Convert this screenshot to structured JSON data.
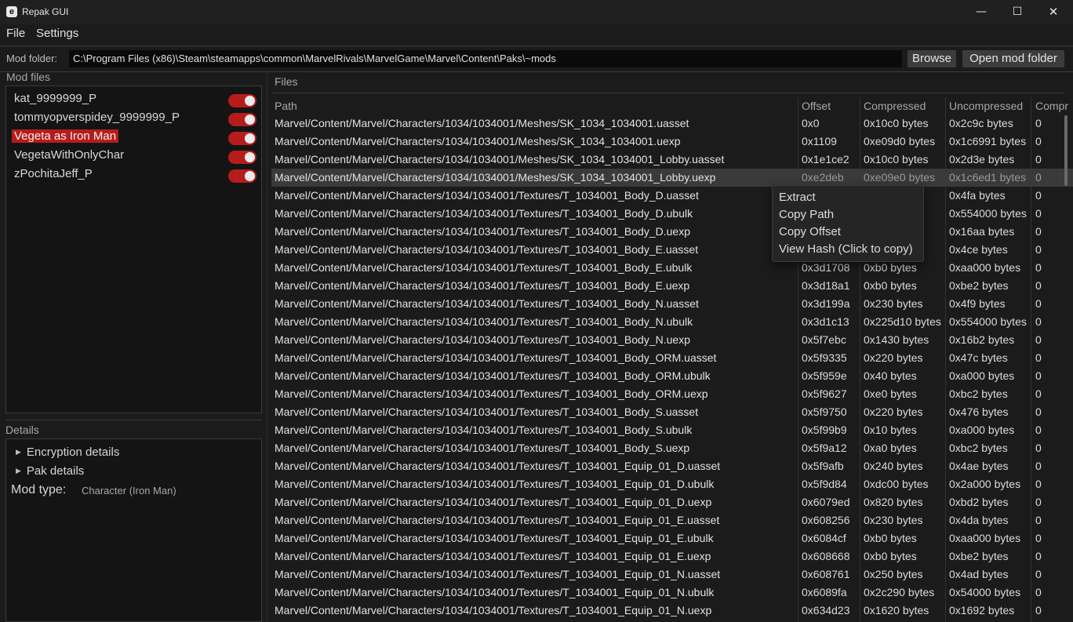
{
  "window": {
    "title": "Repak GUI",
    "icon_letter": "e"
  },
  "menu": {
    "file": "File",
    "settings": "Settings"
  },
  "mod_folder": {
    "label": "Mod folder:",
    "path": "C:\\Program Files (x86)\\Steam\\steamapps\\common\\MarvelRivals\\MarvelGame\\Marvel\\Content\\Paks\\~mods",
    "browse": "Browse",
    "open": "Open mod folder"
  },
  "mod_files": {
    "label": "Mod files",
    "items": [
      {
        "name": "kat_9999999_P",
        "enabled": true
      },
      {
        "name": "tommyopverspidey_9999999_P",
        "enabled": true
      },
      {
        "name": "Vegeta as Iron Man",
        "enabled": true
      },
      {
        "name": "VegetaWithOnlyChar",
        "enabled": true
      },
      {
        "name": "zPochitaJeff_P",
        "enabled": true
      }
    ]
  },
  "details": {
    "label": "Details",
    "encryption": "Encryption details",
    "pak": "Pak details",
    "mod_type_label": "Mod type:",
    "mod_type_value": "Character (Iron Man)"
  },
  "files": {
    "label": "Files",
    "headers": [
      "Path",
      "Offset",
      "Compressed",
      "Uncompressed",
      "Compr"
    ],
    "rows": [
      [
        "Marvel/Content/Marvel/Characters/1034/1034001/Meshes/SK_1034_1034001.uasset",
        "0x0",
        "0x10c0 bytes",
        "0x2c9c bytes",
        "0"
      ],
      [
        "Marvel/Content/Marvel/Characters/1034/1034001/Meshes/SK_1034_1034001.uexp",
        "0x1109",
        "0xe09d0 bytes",
        "0x1c6991 bytes",
        "0"
      ],
      [
        "Marvel/Content/Marvel/Characters/1034/1034001/Meshes/SK_1034_1034001_Lobby.uasset",
        "0x1e1ce2",
        "0x10c0 bytes",
        "0x2d3e bytes",
        "0"
      ],
      [
        "Marvel/Content/Marvel/Characters/1034/1034001/Meshes/SK_1034_1034001_Lobby.uexp",
        "0xe2deb",
        "0xe09e0 bytes",
        "0x1c6ed1 bytes",
        "0"
      ],
      [
        "Marvel/Content/Marvel/Characters/1034/1034001/Textures/T_1034001_Body_D.uasset",
        "",
        "",
        "0x4fa bytes",
        "0"
      ],
      [
        "Marvel/Content/Marvel/Characters/1034/1034001/Textures/T_1034001_Body_D.ubulk",
        "",
        "tes",
        "0x554000 bytes",
        "0"
      ],
      [
        "Marvel/Content/Marvel/Characters/1034/1034001/Textures/T_1034001_Body_D.uexp",
        "",
        "s",
        "0x16aa bytes",
        "0"
      ],
      [
        "Marvel/Content/Marvel/Characters/1034/1034001/Textures/T_1034001_Body_E.uasset",
        "",
        "",
        "0x4ce bytes",
        "0"
      ],
      [
        "Marvel/Content/Marvel/Characters/1034/1034001/Textures/T_1034001_Body_E.ubulk",
        "0x3d1708",
        "0xb0 bytes",
        "0xaa000 bytes",
        "0"
      ],
      [
        "Marvel/Content/Marvel/Characters/1034/1034001/Textures/T_1034001_Body_E.uexp",
        "0x3d18a1",
        "0xb0 bytes",
        "0xbe2 bytes",
        "0"
      ],
      [
        "Marvel/Content/Marvel/Characters/1034/1034001/Textures/T_1034001_Body_N.uasset",
        "0x3d199a",
        "0x230 bytes",
        "0x4f9 bytes",
        "0"
      ],
      [
        "Marvel/Content/Marvel/Characters/1034/1034001/Textures/T_1034001_Body_N.ubulk",
        "0x3d1c13",
        "0x225d10 bytes",
        "0x554000 bytes",
        "0"
      ],
      [
        "Marvel/Content/Marvel/Characters/1034/1034001/Textures/T_1034001_Body_N.uexp",
        "0x5f7ebc",
        "0x1430 bytes",
        "0x16b2 bytes",
        "0"
      ],
      [
        "Marvel/Content/Marvel/Characters/1034/1034001/Textures/T_1034001_Body_ORM.uasset",
        "0x5f9335",
        "0x220 bytes",
        "0x47c bytes",
        "0"
      ],
      [
        "Marvel/Content/Marvel/Characters/1034/1034001/Textures/T_1034001_Body_ORM.ubulk",
        "0x5f959e",
        "0x40 bytes",
        "0xa000 bytes",
        "0"
      ],
      [
        "Marvel/Content/Marvel/Characters/1034/1034001/Textures/T_1034001_Body_ORM.uexp",
        "0x5f9627",
        "0xe0 bytes",
        "0xbc2 bytes",
        "0"
      ],
      [
        "Marvel/Content/Marvel/Characters/1034/1034001/Textures/T_1034001_Body_S.uasset",
        "0x5f9750",
        "0x220 bytes",
        "0x476 bytes",
        "0"
      ],
      [
        "Marvel/Content/Marvel/Characters/1034/1034001/Textures/T_1034001_Body_S.ubulk",
        "0x5f99b9",
        "0x10 bytes",
        "0xa000 bytes",
        "0"
      ],
      [
        "Marvel/Content/Marvel/Characters/1034/1034001/Textures/T_1034001_Body_S.uexp",
        "0x5f9a12",
        "0xa0 bytes",
        "0xbc2 bytes",
        "0"
      ],
      [
        "Marvel/Content/Marvel/Characters/1034/1034001/Textures/T_1034001_Equip_01_D.uasset",
        "0x5f9afb",
        "0x240 bytes",
        "0x4ae bytes",
        "0"
      ],
      [
        "Marvel/Content/Marvel/Characters/1034/1034001/Textures/T_1034001_Equip_01_D.ubulk",
        "0x5f9d84",
        "0xdc00 bytes",
        "0x2a000 bytes",
        "0"
      ],
      [
        "Marvel/Content/Marvel/Characters/1034/1034001/Textures/T_1034001_Equip_01_D.uexp",
        "0x6079ed",
        "0x820 bytes",
        "0xbd2 bytes",
        "0"
      ],
      [
        "Marvel/Content/Marvel/Characters/1034/1034001/Textures/T_1034001_Equip_01_E.uasset",
        "0x608256",
        "0x230 bytes",
        "0x4da bytes",
        "0"
      ],
      [
        "Marvel/Content/Marvel/Characters/1034/1034001/Textures/T_1034001_Equip_01_E.ubulk",
        "0x6084cf",
        "0xb0 bytes",
        "0xaa000 bytes",
        "0"
      ],
      [
        "Marvel/Content/Marvel/Characters/1034/1034001/Textures/T_1034001_Equip_01_E.uexp",
        "0x608668",
        "0xb0 bytes",
        "0xbe2 bytes",
        "0"
      ],
      [
        "Marvel/Content/Marvel/Characters/1034/1034001/Textures/T_1034001_Equip_01_N.uasset",
        "0x608761",
        "0x250 bytes",
        "0x4ad bytes",
        "0"
      ],
      [
        "Marvel/Content/Marvel/Characters/1034/1034001/Textures/T_1034001_Equip_01_N.ubulk",
        "0x6089fa",
        "0x2c290 bytes",
        "0x54000 bytes",
        "0"
      ],
      [
        "Marvel/Content/Marvel/Characters/1034/1034001/Textures/T_1034001_Equip_01_N.uexp",
        "0x634d23",
        "0x1620 bytes",
        "0x1692 bytes",
        "0"
      ]
    ]
  },
  "context_menu": {
    "extract": "Extract",
    "copy_path": "Copy Path",
    "copy_offset": "Copy Offset",
    "view_hash": "View Hash (Click to copy)"
  },
  "colors": {
    "accent": "#b71c1c",
    "background": "#1b1b1b",
    "panel": "#141414"
  },
  "icons": {
    "minimize": "minimize-icon",
    "maximize": "maximize-icon",
    "close": "close-icon",
    "expand": "triangle-right-icon"
  }
}
